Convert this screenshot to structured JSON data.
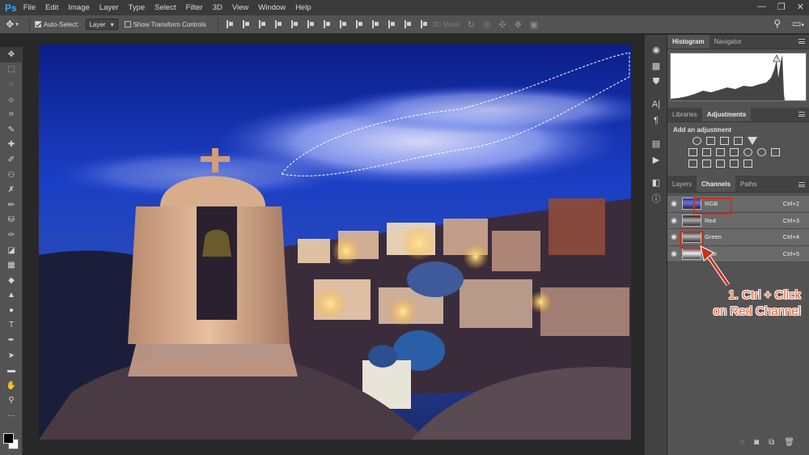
{
  "app": {
    "logo": "Ps",
    "menu": [
      "File",
      "Edit",
      "Image",
      "Layer",
      "Type",
      "Select",
      "Filter",
      "3D",
      "View",
      "Window",
      "Help"
    ],
    "window_controls": [
      "—",
      "❐",
      "✕"
    ]
  },
  "options": {
    "auto_select_label": "Auto-Select:",
    "auto_select_value": "Layer",
    "show_transform_label": "Show Transform Controls",
    "mode_3d_label": "3D Mode:"
  },
  "panels": {
    "top_tabs": [
      "Histogram",
      "Navigator"
    ],
    "mid_tabs": [
      "Libraries",
      "Adjustments"
    ],
    "adjustments_title": "Add an adjustment",
    "lower_tabs": [
      "Layers",
      "Channels",
      "Paths"
    ],
    "channels": [
      {
        "name": "RGB",
        "shortcut": "Ctrl+2"
      },
      {
        "name": "Red",
        "shortcut": "Ctrl+3"
      },
      {
        "name": "Green",
        "shortcut": "Ctrl+4"
      },
      {
        "name": "Blue",
        "shortcut": "Ctrl+5"
      }
    ]
  },
  "annotation": {
    "line1": "1. Ctrl + Click",
    "line2": "on Red Channel",
    "color": "#f25a2a"
  },
  "colors": {
    "accent": "#31a8ff",
    "highlight_box": "#c8321f"
  }
}
